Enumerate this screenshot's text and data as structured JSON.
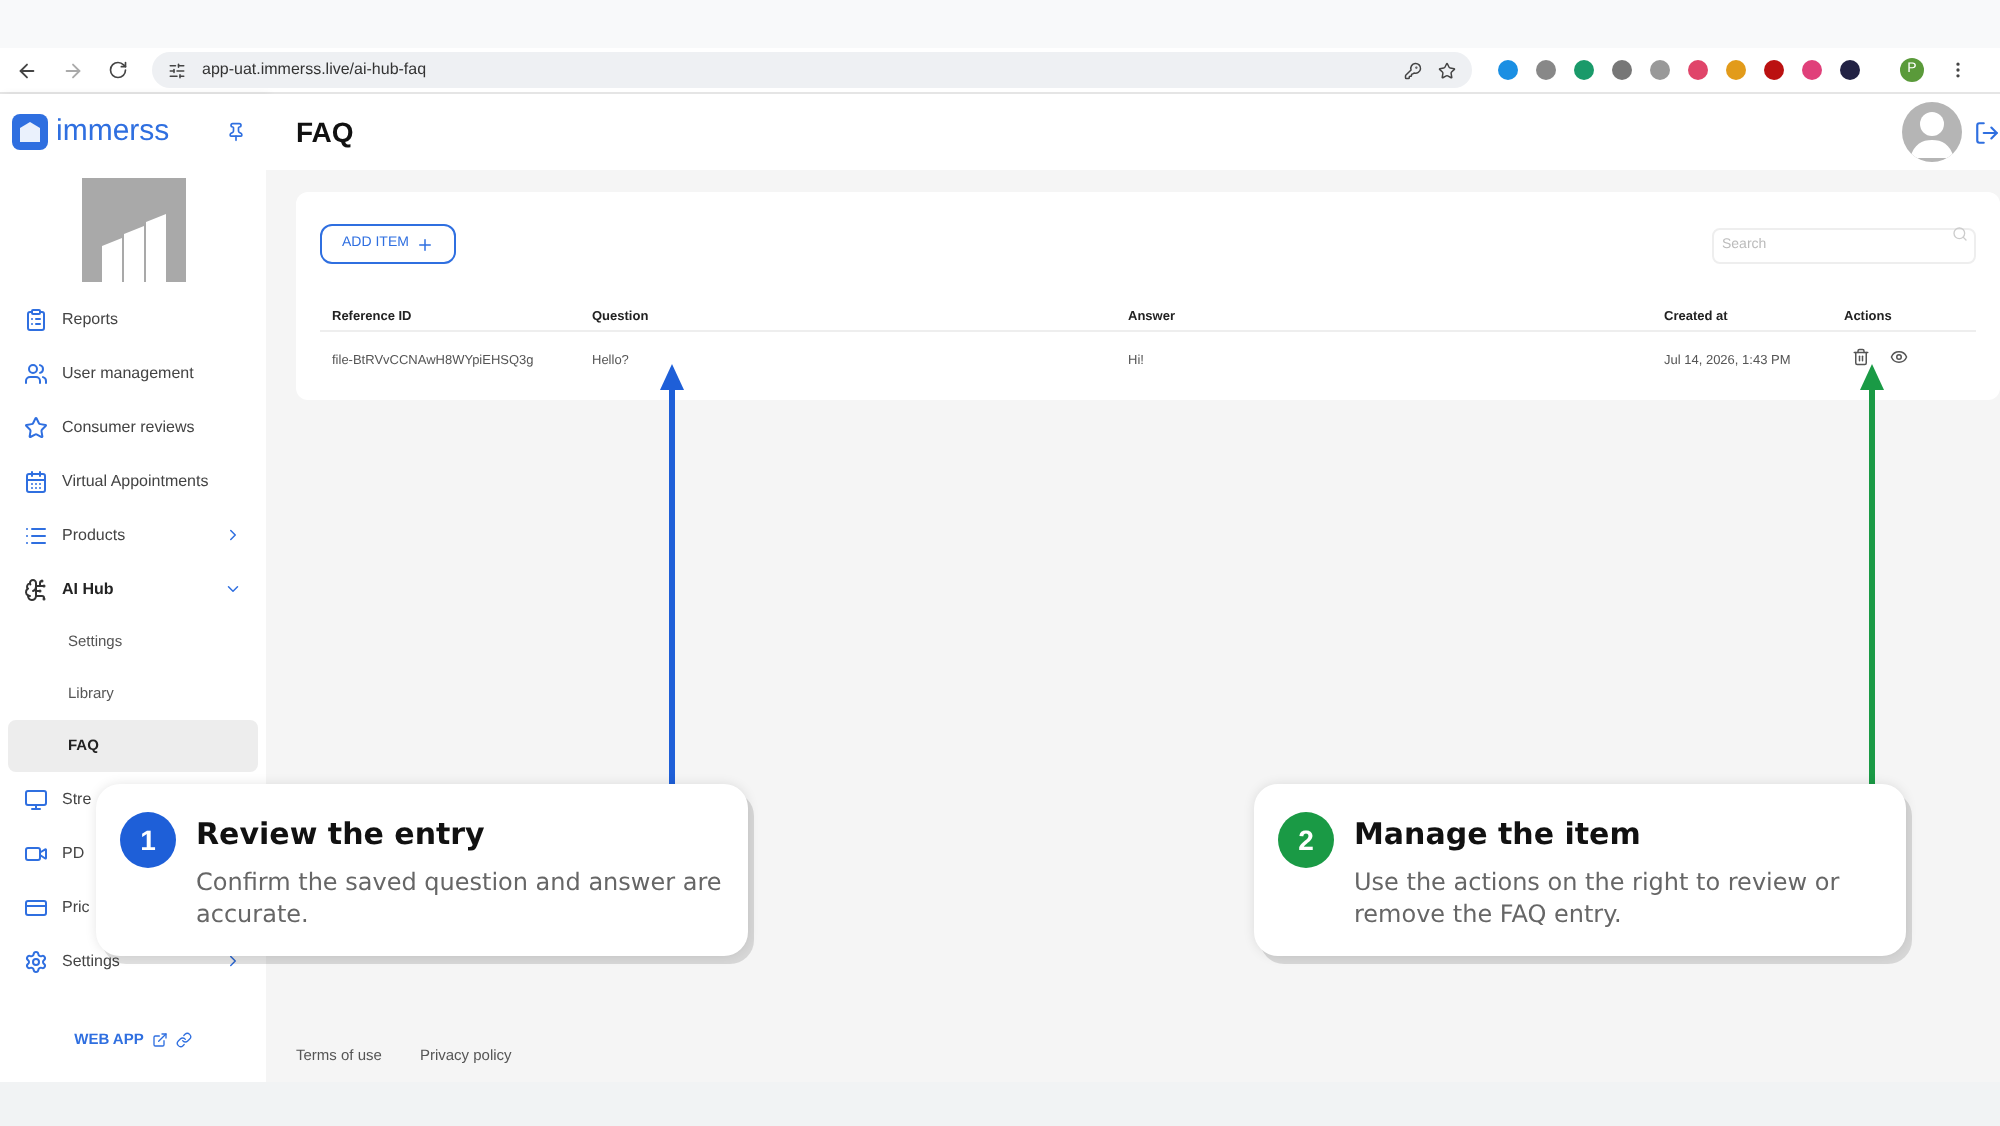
{
  "browser": {
    "url": "app-uat.immerss.live/ai-hub-faq",
    "profile_initial": "P"
  },
  "sidebar": {
    "logo_text": "immerss",
    "items": [
      {
        "label": "Reports",
        "selected": false
      },
      {
        "label": "User management",
        "selected": false
      },
      {
        "label": "Consumer reviews",
        "selected": false
      },
      {
        "label": "Virtual Appointments",
        "selected": false
      },
      {
        "label": "Products",
        "selected": false,
        "expanded": false
      },
      {
        "label": "AI Hub",
        "selected": false,
        "expanded": true,
        "children": [
          {
            "label": "Settings",
            "selected": false
          },
          {
            "label": "Library",
            "selected": false
          },
          {
            "label": "FAQ",
            "selected": true
          }
        ]
      },
      {
        "label": "Stre",
        "selected": false
      },
      {
        "label": "PD",
        "selected": false
      },
      {
        "label": "Pric",
        "selected": false
      },
      {
        "label": "Settings",
        "selected": false,
        "expanded": false
      }
    ],
    "web_app_link": "WEB APP"
  },
  "header": {
    "title": "FAQ"
  },
  "content": {
    "add_button": "ADD ITEM",
    "search": {
      "placeholder": "Search"
    },
    "table": {
      "columns": [
        "Reference ID",
        "Question",
        "Answer",
        "Created at",
        "Actions"
      ],
      "rows": [
        {
          "cells": [
            "file-BtRVvCCNAwH8WYpiEHSQ3g",
            "Hello?",
            "Hi!",
            "Jul 14, 2026, 1:43 PM"
          ]
        }
      ]
    }
  },
  "footer": {
    "links": [
      "Terms of use",
      "Privacy policy"
    ]
  },
  "callouts": [
    {
      "number": "1",
      "title": "Review the entry",
      "text": "Confirm the saved question and answer are accurate.",
      "color": "#1e5fd8"
    },
    {
      "number": "2",
      "title": "Manage the item",
      "text": "Use the actions on the right to review or remove the FAQ entry.",
      "color": "#1a9a45"
    }
  ]
}
